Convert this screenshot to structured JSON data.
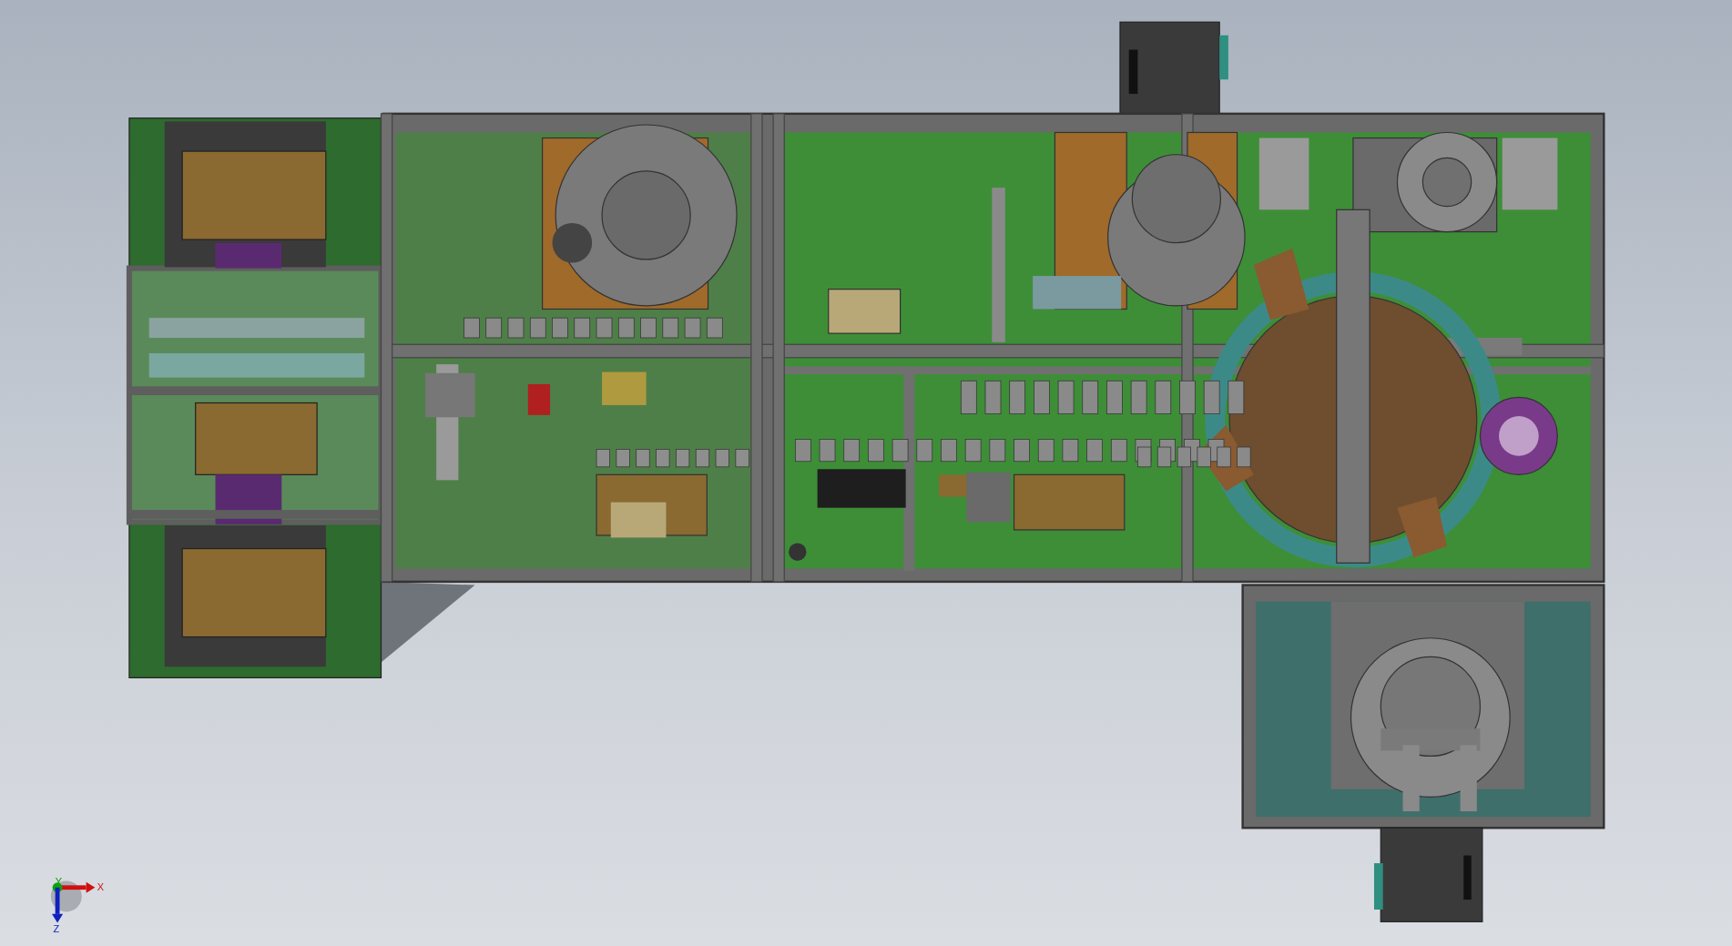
{
  "viewport": {
    "triad": {
      "axes": [
        {
          "label": "X"
        },
        {
          "label": "Y"
        },
        {
          "label": "Z"
        }
      ]
    }
  }
}
